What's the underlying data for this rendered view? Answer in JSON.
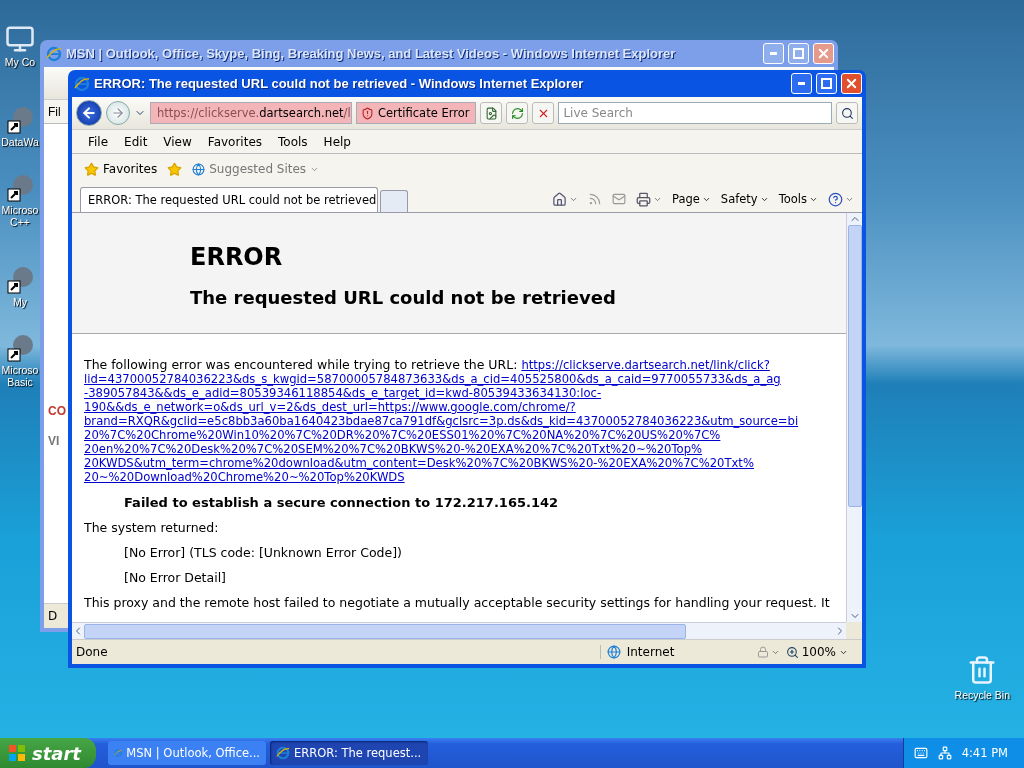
{
  "desktop_icons": [
    {
      "lines": [
        "My Co"
      ],
      "kind": "computer"
    },
    {
      "lines": [
        "DataWa"
      ],
      "kind": "shortcut"
    },
    {
      "lines": [
        "Microso",
        "C++"
      ],
      "kind": "shortcut"
    },
    {
      "lines": [
        "My"
      ],
      "kind": "shortcut"
    },
    {
      "lines": [
        "Microso",
        "Basic"
      ],
      "kind": "shortcut"
    }
  ],
  "recycle_bin": {
    "label": "Recycle Bin"
  },
  "back_window": {
    "title": "MSN | Outlook, Office, Skype, Bing, Breaking News, and Latest Videos - Windows Internet Explorer",
    "menu_fragment": "Fil",
    "headline_fragment": "CO",
    "nav_fragment": "VI",
    "status_fragment": "D"
  },
  "window": {
    "title": "ERROR: The requested URL could not be retrieved - Windows Internet Explorer",
    "address": {
      "parts": [
        {
          "text": "https://clickserve.",
          "kind": "dim"
        },
        {
          "text": "dartsearch.net",
          "kind": "host"
        },
        {
          "text": "/l",
          "kind": "dim"
        }
      ]
    },
    "certificate_error": "Certificate Error",
    "search": {
      "placeholder": "Live Search"
    },
    "menu": [
      "File",
      "Edit",
      "View",
      "Favorites",
      "Tools",
      "Help"
    ],
    "favorites": {
      "label": "Favorites",
      "suggested": "Suggested Sites"
    },
    "tabs": [
      {
        "label": "ERROR: The requested URL could not be retrieved",
        "selected": true
      }
    ],
    "command_bar": [
      "Page",
      "Safety",
      "Tools"
    ],
    "page": {
      "heading": "ERROR",
      "subheading": "The requested URL could not be retrieved",
      "intro": "The following error was encountered while trying to retrieve the URL:",
      "url_lines": [
        "https://clickserve.dartsearch.net/link/click?",
        "lid=43700052784036223&ds_s_kwgid=58700005784873633&ds_a_cid=405525800&ds_a_caid=9770055733&ds_a_ag",
        "-389057843&&ds_e_adid=80539346118854&ds_e_target_id=kwd-80539433634130:loc-",
        "190&&ds_e_network=o&ds_url_v=2&ds_dest_url=https://www.google.com/chrome/?",
        "brand=RXQR&gclid=e5c8bb3a60ba1640423bdae87ca791df&gclsrc=3p.ds&ds_kid=43700052784036223&utm_source=bi",
        "20%7C%20Chrome%20Win10%20%7C%20DR%20%7C%20ESS01%20%7C%20NA%20%7C%20US%20%7C%",
        "20en%20%7C%20Desk%20%7C%20SEM%20%7C%20BKWS%20-%20EXA%20%7C%20Txt%20~%20Top%",
        "20KWDS&utm_term=chrome%20download&utm_content=Desk%20%7C%20BKWS%20-%20EXA%20%7C%20Txt%",
        "20~%20Download%20Chrome%20~%20Top%20KWDS"
      ],
      "failure": "Failed to establish a secure connection to 172.217.165.142",
      "system_returned": "The system returned:",
      "details": [
        "[No Error] (TLS code: [Unknown Error Code])",
        "[No Error Detail]"
      ],
      "explanation": "This proxy and the remote host failed to negotiate a mutually acceptable security settings for handling your request. It"
    },
    "status": {
      "text": "Done",
      "zone": "Internet",
      "zoom": "100%"
    }
  },
  "taskbar": {
    "start": "start",
    "items": [
      {
        "label": "MSN | Outlook, Office...",
        "selected": false
      },
      {
        "label": "ERROR: The request...",
        "selected": true
      }
    ],
    "clock": "4:41 PM"
  }
}
